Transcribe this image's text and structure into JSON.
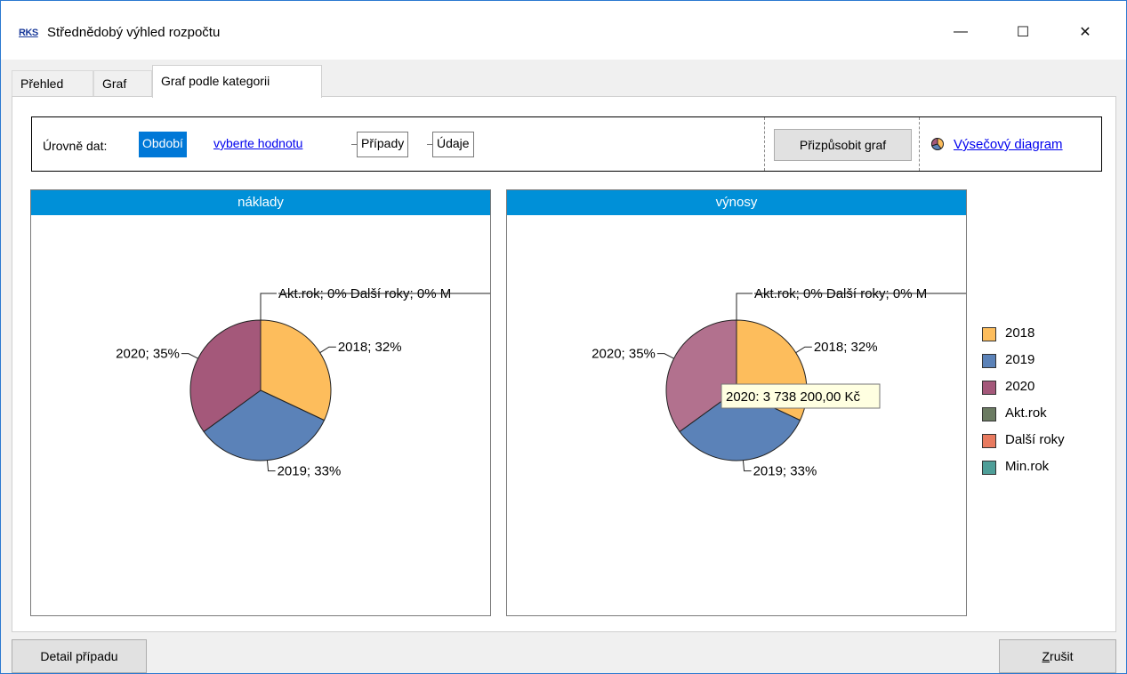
{
  "window": {
    "app_icon_text": "RKS",
    "title": "Střednědobý výhled rozpočtu",
    "minimize_glyph": "—",
    "maximize_glyph": "☐",
    "close_glyph": "✕"
  },
  "tabs": [
    {
      "label": "Přehled",
      "active": false
    },
    {
      "label": "Graf",
      "active": false
    },
    {
      "label": "Graf podle kategorii",
      "active": true
    }
  ],
  "toolbar": {
    "levels_label": "Úrovně dat:",
    "crumbs": [
      {
        "label": "Období",
        "state": "active"
      },
      {
        "label": "vyberte hodnotu",
        "state": "link"
      },
      {
        "label": "Případy",
        "state": "boxed"
      },
      {
        "label": "Údaje",
        "state": "boxed"
      }
    ],
    "fit_button": "Přizpůsobit graf",
    "chart_type_icon": "pie-chart-icon",
    "chart_type_link": "Výsečový diagram"
  },
  "colors": {
    "header": "#0090d8",
    "2018": "#fdbd5c",
    "2019": "#5b82b8",
    "2020": "#a4587a",
    "Akt.rok": "#6b7b62",
    "Další roky": "#e87a5f",
    "Min.rok": "#4e9e98"
  },
  "chart_data": [
    {
      "type": "pie",
      "title": "náklady",
      "slices": [
        {
          "label": "2018",
          "percent": 32,
          "text": "2018; 32%"
        },
        {
          "label": "2019",
          "percent": 33,
          "text": "2019; 33%"
        },
        {
          "label": "2020",
          "percent": 35,
          "text": "2020; 35%"
        }
      ],
      "zero_labels": "Akt.rok; 0% Další roky; 0% M"
    },
    {
      "type": "pie",
      "title": "výnosy",
      "slices": [
        {
          "label": "2018",
          "percent": 32,
          "text": "2018; 32%"
        },
        {
          "label": "2019",
          "percent": 33,
          "text": "2019; 33%"
        },
        {
          "label": "2020",
          "percent": 35,
          "text": "2020; 35%"
        }
      ],
      "zero_labels": "Akt.rok; 0% Další roky; 0% M",
      "tooltip": "2020: 3 738 200,00 Kč",
      "highlighted_slice": "2020"
    }
  ],
  "legend": [
    "2018",
    "2019",
    "2020",
    "Akt.rok",
    "Další roky",
    "Min.rok"
  ],
  "bottom": {
    "detail_button": "Detail případu",
    "cancel_button": "Zrušit"
  }
}
